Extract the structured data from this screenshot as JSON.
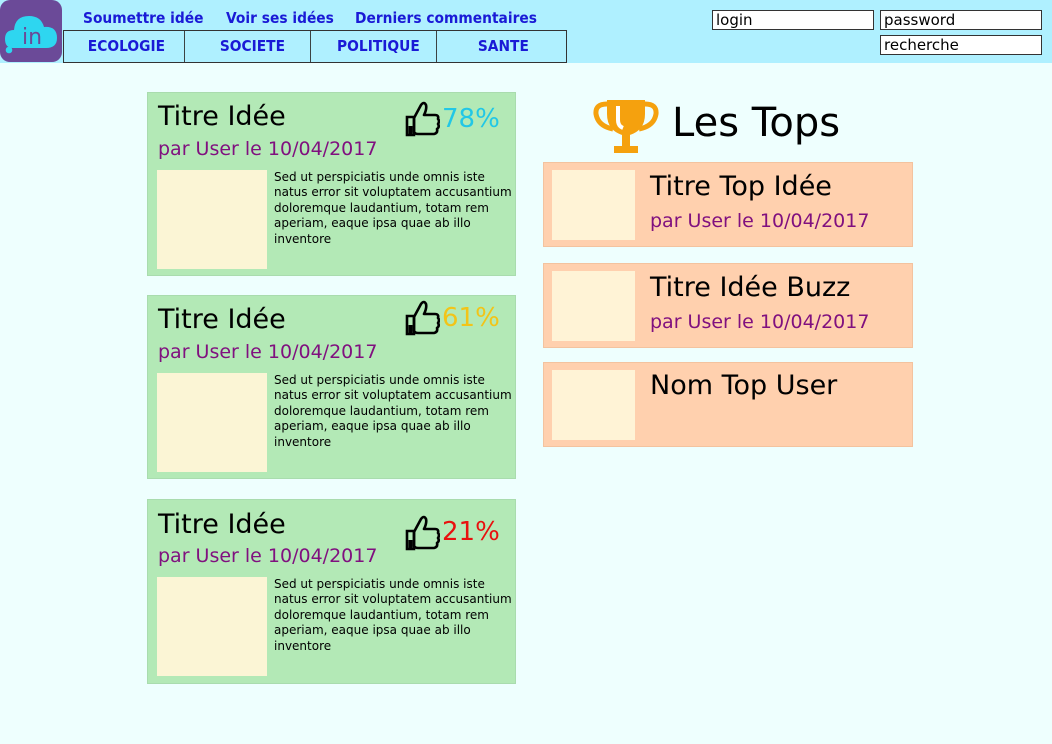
{
  "logo": {
    "text": "in",
    "icon": "cloud-icon",
    "bg": "#6b4a98",
    "accent": "#2ed6f0"
  },
  "nav": {
    "links": [
      "Soumettre idée",
      "Voir ses idées",
      "Derniers commentaires"
    ],
    "categories": [
      "ECOLOGIE",
      "SOCIETE",
      "POLITIQUE",
      "SANTE"
    ],
    "link_color": "#1a1ad6"
  },
  "auth": {
    "login_placeholder": "login",
    "password_placeholder": "password"
  },
  "search": {
    "placeholder": "recherche"
  },
  "ideas": [
    {
      "title": "Titre Idée",
      "byline": "par User le 10/04/2017",
      "percent": "78%",
      "percent_color": "#22c7e6",
      "text": "Sed ut perspiciatis unde omnis iste natus error sit voluptatem accusantium doloremque laudantium, totam rem aperiam, eaque ipsa quae ab illo inventore"
    },
    {
      "title": "Titre Idée",
      "byline": "par User le 10/04/2017",
      "percent": "61%",
      "percent_color": "#f2c418",
      "text": "Sed ut perspiciatis unde omnis iste natus error sit voluptatem accusantium doloremque laudantium, totam rem aperiam, eaque ipsa quae ab illo inventore"
    },
    {
      "title": "Titre Idée",
      "byline": "par User le 10/04/2017",
      "percent": "21%",
      "percent_color": "#e8110f",
      "text": "Sed ut perspiciatis unde omnis iste natus error sit voluptatem accusantium doloremque laudantium, totam rem aperiam, eaque ipsa quae ab illo inventore"
    }
  ],
  "tops": {
    "heading": "Les Tops",
    "icon": "trophy-icon",
    "items": [
      {
        "title": "Titre Top Idée",
        "byline": "par User le 10/04/2017"
      },
      {
        "title": "Titre Idée Buzz",
        "byline": "par User le 10/04/2017"
      },
      {
        "title": "Nom Top User"
      }
    ]
  }
}
